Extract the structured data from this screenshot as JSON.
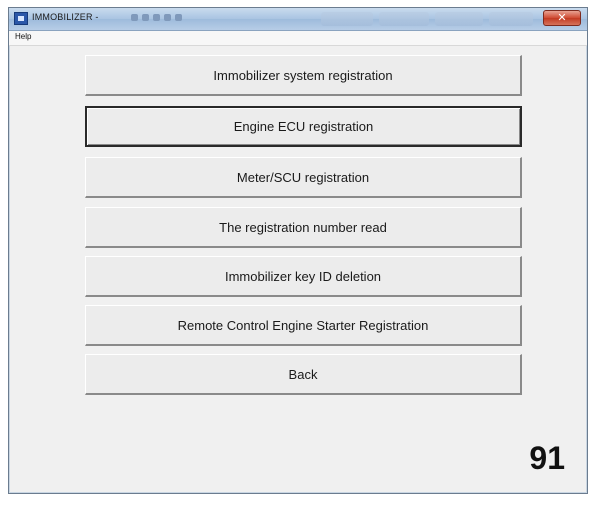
{
  "window": {
    "title": "IMMOBILIZER -",
    "close_label": "✕"
  },
  "menubar": {
    "items": [
      "Help"
    ]
  },
  "buttons": [
    {
      "label": "Immobilizer system registration",
      "focused": false
    },
    {
      "label": "Engine ECU registration",
      "focused": true
    },
    {
      "label": "Meter/SCU registration",
      "focused": false
    },
    {
      "label": "The registration number read",
      "focused": false
    },
    {
      "label": "Immobilizer key ID deletion",
      "focused": false
    },
    {
      "label": "Remote Control Engine Starter Registration",
      "focused": false
    },
    {
      "label": "Back",
      "focused": false
    }
  ],
  "page_number": "91"
}
